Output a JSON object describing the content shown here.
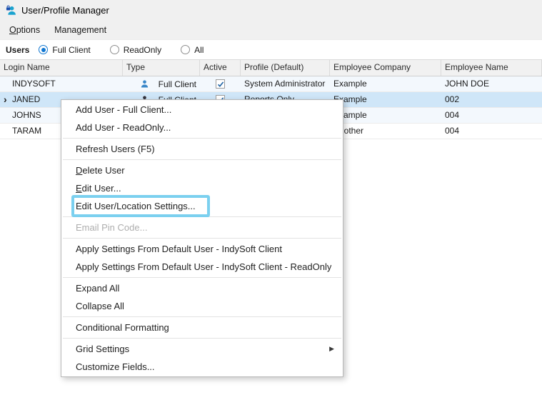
{
  "window": {
    "title": "User/Profile Manager"
  },
  "menubar": {
    "items": [
      {
        "label": "Options"
      },
      {
        "label": "Management"
      }
    ]
  },
  "filter": {
    "label": "Users",
    "options": [
      {
        "label": "Full Client",
        "selected": true
      },
      {
        "label": "ReadOnly",
        "selected": false
      },
      {
        "label": "All",
        "selected": false
      }
    ]
  },
  "grid": {
    "columns": [
      "Login Name",
      "Type",
      "Active",
      "Profile (Default)",
      "Employee Company",
      "Employee Name"
    ],
    "rows": [
      {
        "login": "INDYSOFT",
        "type": "Full Client",
        "type_icon": "blue",
        "active": true,
        "profile": "System Administrator",
        "company": "Example",
        "employee": "JOHN DOE",
        "selected": false
      },
      {
        "login": "JANED",
        "type": "Full Client",
        "type_icon": "dark",
        "active": true,
        "profile": "Reports Only",
        "company": "Example",
        "employee": "002",
        "selected": true
      },
      {
        "login": "JOHNS",
        "type": "",
        "type_icon": null,
        "active": null,
        "profile": "",
        "company": "Example",
        "employee": "004",
        "selected": false
      },
      {
        "login": "TARAM",
        "type": "",
        "type_icon": null,
        "active": null,
        "profile": "",
        "company": "Another",
        "employee": "004",
        "selected": false
      }
    ]
  },
  "context_menu": {
    "items": [
      {
        "label": "Add User - Full Client..."
      },
      {
        "label": "Add User - ReadOnly..."
      },
      {
        "separator": true
      },
      {
        "label": "Refresh Users (F5)"
      },
      {
        "separator": true
      },
      {
        "label": "Delete User",
        "accel_first": true
      },
      {
        "label": "Edit User...",
        "accel_first": true
      },
      {
        "label": "Edit User/Location Settings...",
        "highlighted": true
      },
      {
        "separator": true
      },
      {
        "label": "Email Pin Code...",
        "disabled": true
      },
      {
        "separator": true
      },
      {
        "label": "Apply Settings From Default User - IndySoft Client"
      },
      {
        "label": "Apply Settings From Default User - IndySoft Client - ReadOnly"
      },
      {
        "separator": true
      },
      {
        "label": "Expand All"
      },
      {
        "label": "Collapse All"
      },
      {
        "separator": true
      },
      {
        "label": "Conditional Formatting"
      },
      {
        "separator": true
      },
      {
        "label": "Grid Settings",
        "submenu": true
      },
      {
        "label": "Customize Fields..."
      }
    ]
  },
  "colors": {
    "accent": "#1177d1",
    "highlight": "#7bd0ef",
    "selected_row": "#cfe6f8",
    "icon_blue": "#3a87c8",
    "icon_dark": "#33333d",
    "titlebar_icon": "#1ba3cf"
  }
}
